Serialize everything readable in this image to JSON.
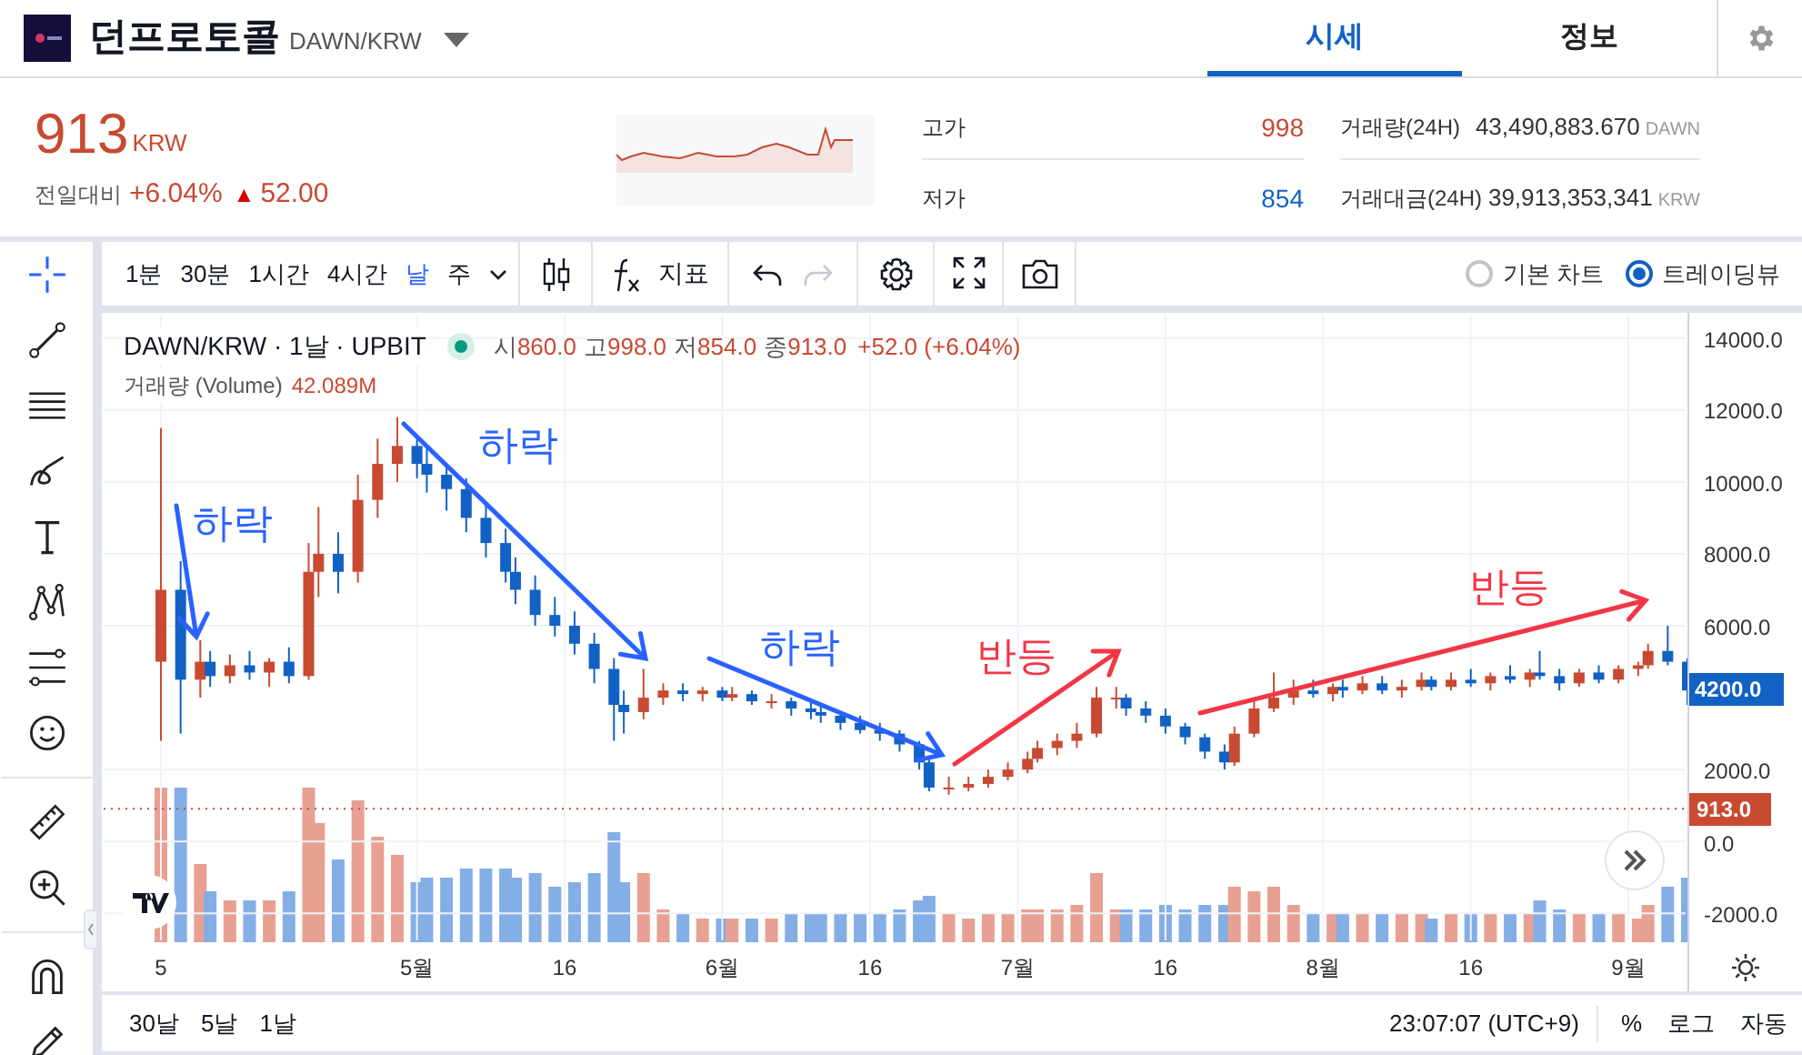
{
  "coin": {
    "name": "던프로토콜",
    "pair": "DAWN/KRW"
  },
  "tabs": [
    {
      "label": "시세",
      "selected": true
    },
    {
      "label": "정보",
      "selected": false
    }
  ],
  "price": {
    "value": "913",
    "unit": "KRW",
    "change_label": "전일대비",
    "change_pct": "+6.04%",
    "change_arrow": "▲",
    "change_abs": "52.00"
  },
  "stats": [
    {
      "kind": "high",
      "label": "고가",
      "value": "998"
    },
    {
      "kind": "volume",
      "label": "거래량(24H)",
      "value": "43,490,883.670",
      "unit": "DAWN"
    },
    {
      "kind": "low",
      "label": "저가",
      "value": "854"
    },
    {
      "kind": "volume",
      "label": "거래대금(24H)",
      "value": "39,913,353,341",
      "unit": "KRW"
    }
  ],
  "intervals": [
    {
      "label": "1분",
      "selected": false
    },
    {
      "label": "30분",
      "selected": false
    },
    {
      "label": "1시간",
      "selected": false
    },
    {
      "label": "4시간",
      "selected": false
    },
    {
      "label": "날",
      "selected": true
    },
    {
      "label": "주",
      "selected": false
    }
  ],
  "indicator_button": "지표",
  "history": [
    {
      "kind": "undo",
      "disabled": false
    },
    {
      "kind": "redo",
      "disabled": true
    }
  ],
  "chart_types": [
    {
      "label": "기본 차트",
      "selected": false
    },
    {
      "label": "트레이딩뷰",
      "selected": true
    }
  ],
  "legend": {
    "ohlc": [
      {
        "label": "시",
        "value": "860.0"
      },
      {
        "label": "고",
        "value": "998.0"
      },
      {
        "label": "저",
        "value": "854.0"
      },
      {
        "label": "종",
        "value": "913.0"
      }
    ],
    "change": "+52.0 (+6.04%)",
    "volume_label": "거래량 (Volume)",
    "volume": "42.089M"
  },
  "chart": {
    "chart_data": {
      "type": "candlestick",
      "title": "DAWN/KRW · 1날 · UPBIT",
      "x": [
        "--04-05",
        "--04-07",
        "--04-09",
        "--04-10",
        "--04-12",
        "--04-14",
        "--04-16",
        "--04-18",
        "--04-20",
        "--04-21",
        "--04-23",
        "--04-25",
        "--04-27",
        "--04-29",
        "--05-01",
        "--05-02",
        "--05-04",
        "--05-06",
        "--05-08",
        "--05-10",
        "--05-11",
        "--05-13",
        "--05-15",
        "--05-17",
        "--05-19",
        "--05-21",
        "--05-22",
        "--05-24",
        "--05-26",
        "--05-28",
        "--05-30",
        "--06-01",
        "--06-02",
        "--06-04",
        "--06-06",
        "--06-08",
        "--06-10",
        "--06-11",
        "--06-13",
        "--06-15",
        "--06-17",
        "--06-19",
        "--06-21",
        "--06-22",
        "--06-24",
        "--06-26",
        "--06-28",
        "--06-30",
        "--07-02",
        "--07-03",
        "--07-05",
        "--07-07",
        "--07-09",
        "--07-11",
        "--07-12",
        "--07-14",
        "--07-16",
        "--07-18",
        "--07-20",
        "--07-22",
        "--07-23",
        "--07-25",
        "--07-27",
        "--07-29",
        "--07-31",
        "--08-02",
        "--08-03",
        "--08-05",
        "--08-07",
        "--08-09",
        "--08-11",
        "--08-12",
        "--08-14",
        "--08-16",
        "--08-18",
        "--08-20",
        "--08-22",
        "--08-23",
        "--08-25",
        "--08-27",
        "--08-29",
        "--08-31",
        "--09-02",
        "--09-03",
        "--09-05",
        "--09-07"
      ],
      "ohlc": [
        [
          5000,
          11500,
          2800,
          7000
        ],
        [
          7000,
          7800,
          3000,
          4500
        ],
        [
          4500,
          5600,
          4000,
          5000
        ],
        [
          5000,
          5300,
          4300,
          4600
        ],
        [
          4600,
          5200,
          4400,
          4900
        ],
        [
          4900,
          5300,
          4500,
          4700
        ],
        [
          4700,
          5100,
          4300,
          5000
        ],
        [
          5000,
          5400,
          4400,
          4600
        ],
        [
          4600,
          8300,
          4500,
          7500
        ],
        [
          7500,
          9300,
          6800,
          8000
        ],
        [
          8000,
          8600,
          6900,
          7500
        ],
        [
          7500,
          10200,
          7200,
          9500
        ],
        [
          9500,
          11200,
          9000,
          10500
        ],
        [
          10500,
          11800,
          10000,
          11000
        ],
        [
          11000,
          11300,
          10100,
          10500
        ],
        [
          10500,
          11000,
          9700,
          10200
        ],
        [
          10200,
          10500,
          9200,
          9800
        ],
        [
          9800,
          10100,
          8600,
          9000
        ],
        [
          9000,
          9400,
          7900,
          8300
        ],
        [
          8300,
          8700,
          7200,
          7500
        ],
        [
          7500,
          7900,
          6600,
          7000
        ],
        [
          7000,
          7400,
          6000,
          6300
        ],
        [
          6300,
          6800,
          5700,
          6000
        ],
        [
          6000,
          6400,
          5200,
          5500
        ],
        [
          5500,
          5800,
          4400,
          4800
        ],
        [
          4800,
          5100,
          2800,
          3800
        ],
        [
          3800,
          4200,
          3000,
          3600
        ],
        [
          3600,
          4800,
          3400,
          4000
        ],
        [
          4000,
          4400,
          3800,
          4200
        ],
        [
          4200,
          4400,
          3900,
          4100
        ],
        [
          4100,
          4300,
          3900,
          4200
        ],
        [
          4200,
          4300,
          3900,
          4000
        ],
        [
          4000,
          4300,
          3900,
          4100
        ],
        [
          4100,
          4200,
          3800,
          3900
        ],
        [
          3900,
          4100,
          3700,
          3900
        ],
        [
          3900,
          4000,
          3500,
          3700
        ],
        [
          3700,
          3900,
          3400,
          3600
        ],
        [
          3600,
          3800,
          3300,
          3500
        ],
        [
          3500,
          3600,
          3100,
          3300
        ],
        [
          3300,
          3500,
          3000,
          3100
        ],
        [
          3100,
          3300,
          2800,
          3000
        ],
        [
          3000,
          3100,
          2500,
          2700
        ],
        [
          2700,
          2800,
          2000,
          2200
        ],
        [
          2200,
          2300,
          1400,
          1500
        ],
        [
          1500,
          1800,
          1300,
          1500
        ],
        [
          1500,
          1800,
          1400,
          1600
        ],
        [
          1600,
          2000,
          1500,
          1800
        ],
        [
          1800,
          2200,
          1700,
          2000
        ],
        [
          2000,
          2500,
          1900,
          2300
        ],
        [
          2300,
          2800,
          2200,
          2600
        ],
        [
          2600,
          3000,
          2400,
          2800
        ],
        [
          2800,
          3300,
          2600,
          3000
        ],
        [
          3000,
          4300,
          2900,
          4000
        ],
        [
          4000,
          4300,
          3700,
          4000
        ],
        [
          4000,
          4100,
          3500,
          3700
        ],
        [
          3700,
          3900,
          3300,
          3500
        ],
        [
          3500,
          3700,
          3000,
          3200
        ],
        [
          3200,
          3300,
          2700,
          2900
        ],
        [
          2900,
          3000,
          2300,
          2500
        ],
        [
          2500,
          2700,
          2000,
          2200
        ],
        [
          2200,
          3200,
          2100,
          3000
        ],
        [
          3000,
          3900,
          2900,
          3700
        ],
        [
          3700,
          4700,
          3600,
          4000
        ],
        [
          4000,
          4500,
          3800,
          4200
        ],
        [
          4200,
          4500,
          4000,
          4100
        ],
        [
          4100,
          4400,
          3900,
          4300
        ],
        [
          4300,
          4500,
          4000,
          4200
        ],
        [
          4200,
          4600,
          4100,
          4400
        ],
        [
          4400,
          4600,
          4100,
          4200
        ],
        [
          4200,
          4500,
          4000,
          4300
        ],
        [
          4300,
          4700,
          4200,
          4500
        ],
        [
          4500,
          4600,
          4200,
          4300
        ],
        [
          4300,
          4700,
          4200,
          4500
        ],
        [
          4500,
          4800,
          4300,
          4400
        ],
        [
          4400,
          4700,
          4200,
          4600
        ],
        [
          4600,
          4900,
          4400,
          4500
        ],
        [
          4500,
          4800,
          4300,
          4700
        ],
        [
          4700,
          5300,
          4500,
          4600
        ],
        [
          4600,
          4800,
          4200,
          4400
        ],
        [
          4400,
          4800,
          4300,
          4700
        ],
        [
          4700,
          4900,
          4400,
          4500
        ],
        [
          4500,
          4900,
          4400,
          4800
        ],
        [
          4800,
          5000,
          4600,
          4900
        ],
        [
          4900,
          5500,
          4800,
          5300
        ],
        [
          5300,
          6000,
          4900,
          5000
        ],
        [
          5000,
          5100,
          3800,
          4200
        ]
      ],
      "ylim": [
        -2800,
        14700
      ],
      "yticks": [
        {
          "value": 14000,
          "label": "14000.0"
        },
        {
          "value": 12000,
          "label": "12000.0"
        },
        {
          "value": 10000,
          "label": "10000.0"
        },
        {
          "value": 8000,
          "label": "8000.0"
        },
        {
          "value": 6000,
          "label": "6000.0"
        },
        {
          "value": 2000,
          "label": "2000.0"
        },
        {
          "value": 0,
          "label": "0.0"
        },
        {
          "value": -2000,
          "label": "-2000.0"
        }
      ],
      "xlim": [
        "--03-30",
        "--09-07"
      ],
      "grid": true,
      "ref_lines": [
        {
          "axis": "y",
          "value": 913,
          "label": "913.0",
          "color": "#c84a31"
        }
      ],
      "xticks": [
        {
          "value": "--04-05",
          "label": "5"
        },
        {
          "value": "--05-01",
          "label": "5월"
        },
        {
          "value": "--05-16",
          "label": "16"
        },
        {
          "value": "--06-01",
          "label": "6월"
        },
        {
          "value": "--06-16",
          "label": "16"
        },
        {
          "value": "--07-01",
          "label": "7월"
        },
        {
          "value": "--07-16",
          "label": "16"
        },
        {
          "value": "--08-01",
          "label": "8월"
        },
        {
          "value": "--08-16",
          "label": "16"
        },
        {
          "value": "--09-01",
          "label": "9월"
        }
      ]
    }
  },
  "last_price_label": "4200.0",
  "annotations": [
    {
      "text": "하락",
      "color": "#2962ff"
    },
    {
      "text": "하락",
      "color": "#2962ff"
    },
    {
      "text": "하락",
      "color": "#2962ff"
    },
    {
      "text": "반등",
      "color": "#f23645"
    },
    {
      "text": "반등",
      "color": "#f23645"
    }
  ],
  "ranges": [
    "30날",
    "5날",
    "1날"
  ],
  "clock": "23:07:07 (UTC+9)",
  "scale_options": [
    "%",
    "로그",
    "자동"
  ]
}
